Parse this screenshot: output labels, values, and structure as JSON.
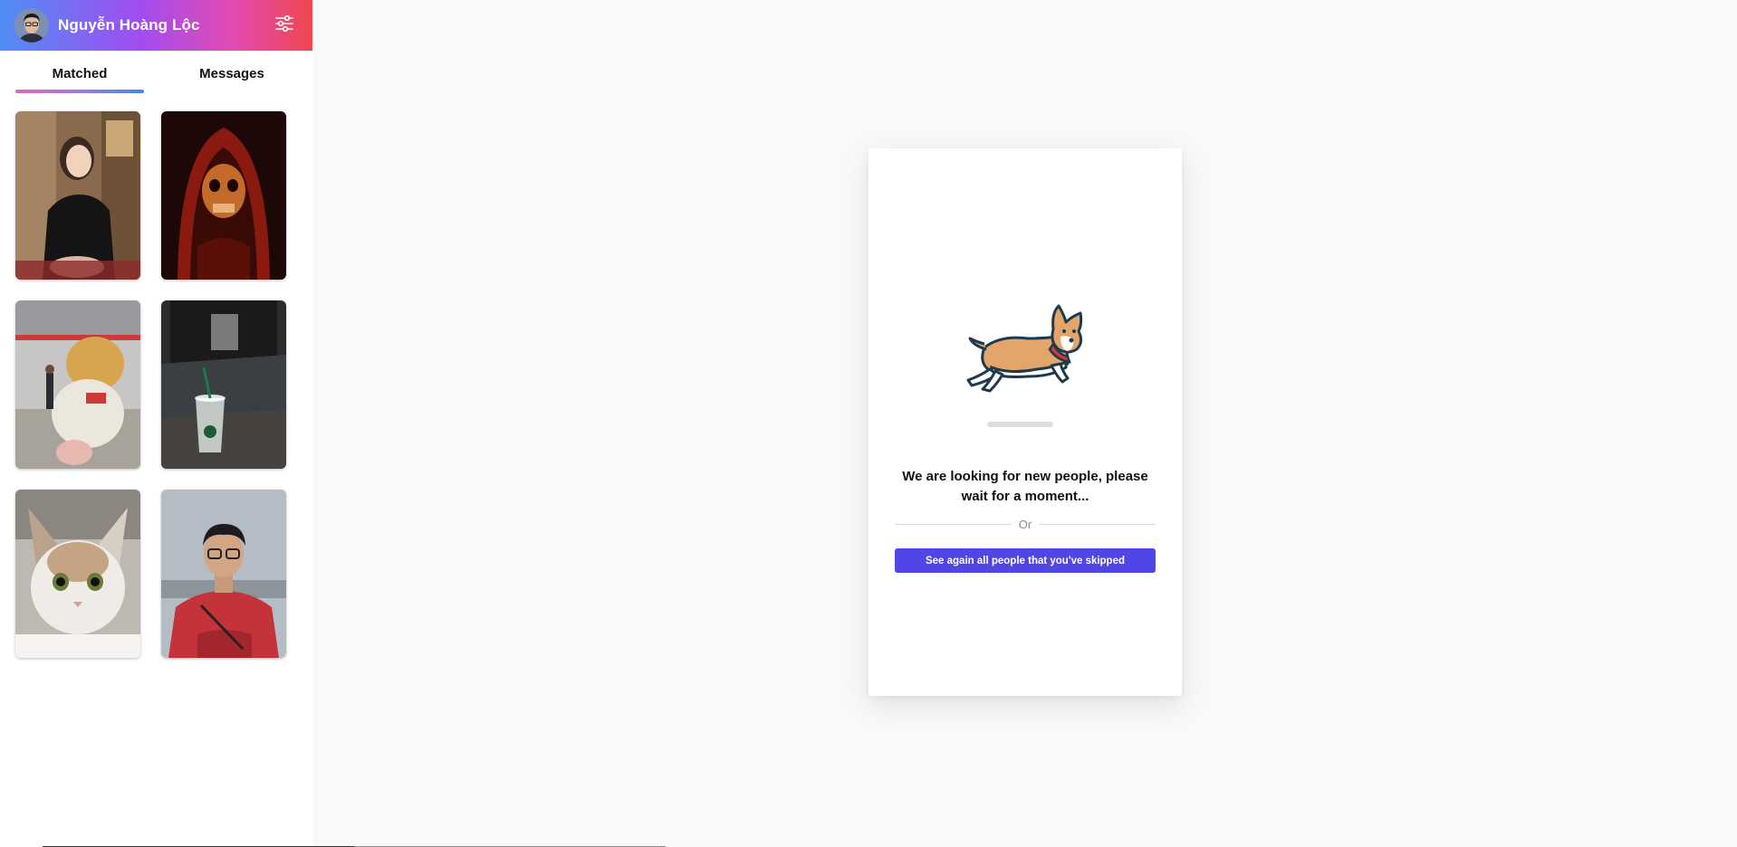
{
  "user": {
    "name": "Nguyễn Hoàng Lộc",
    "avatar_icon": "user-avatar"
  },
  "header": {
    "settings_icon": "sliders-icon",
    "gradient": [
      "#4f8ef5",
      "#a24cf0",
      "#e24bb0",
      "#f0464e"
    ]
  },
  "tabs": [
    {
      "label": "Matched",
      "active": true
    },
    {
      "label": "Messages",
      "active": false
    }
  ],
  "matches": [
    {
      "subject": "woman-in-black-top-photo"
    },
    {
      "subject": "red-hooded-skull-photo"
    },
    {
      "subject": "teddy-bear-mall-photo"
    },
    {
      "subject": "coffee-cup-photo"
    },
    {
      "subject": "white-cat-photo"
    },
    {
      "subject": "man-in-red-shirt-photo"
    }
  ],
  "main": {
    "illustration": "corgi-running-illustration",
    "message": "We are looking for new people, please wait for a moment...",
    "divider_text": "Or",
    "see_again_label": "See again all people that you've skipped",
    "button_color": "#4f46e5"
  }
}
